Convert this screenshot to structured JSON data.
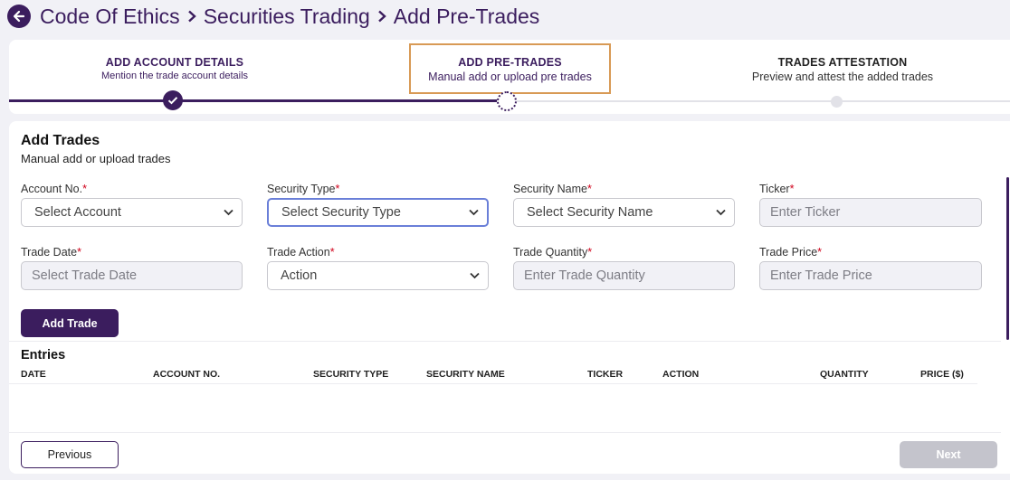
{
  "breadcrumb": {
    "items": [
      "Code Of Ethics",
      "Securities Trading",
      "Add Pre-Trades"
    ]
  },
  "stepper": {
    "steps": [
      {
        "title": "ADD ACCOUNT DETAILS",
        "subtitle": "Mention the trade account details",
        "state": "completed"
      },
      {
        "title": "ADD PRE-TRADES",
        "subtitle": "Manual add or upload pre trades",
        "state": "current"
      },
      {
        "title": "TRADES ATTESTATION",
        "subtitle": "Preview and attest the added trades",
        "state": "upcoming"
      }
    ]
  },
  "form": {
    "title": "Add Trades",
    "subtitle": "Manual add or upload trades",
    "fields": [
      {
        "label": "Account No.",
        "type": "select",
        "value": "Select Account"
      },
      {
        "label": "Security Type",
        "type": "select",
        "value": "Select Security Type"
      },
      {
        "label": "Security Name",
        "type": "select",
        "value": "Select Security Name"
      },
      {
        "label": "Ticker",
        "type": "input",
        "placeholder": "Enter Ticker"
      },
      {
        "label": "Trade Date",
        "type": "input",
        "placeholder": "Select Trade Date"
      },
      {
        "label": "Trade Action",
        "type": "select",
        "value": "Action"
      },
      {
        "label": "Trade Quantity",
        "type": "input",
        "placeholder": "Enter Trade Quantity"
      },
      {
        "label": "Trade Price",
        "type": "input",
        "placeholder": "Enter Trade Price"
      }
    ],
    "required_mark": "*",
    "add_button": "Add Trade"
  },
  "entries": {
    "title": "Entries",
    "columns": [
      "DATE",
      "ACCOUNT NO.",
      "SECURITY TYPE",
      "SECURITY NAME",
      "TICKER",
      "ACTION",
      "QUANTITY",
      "PRICE ($)"
    ],
    "rows": []
  },
  "footer": {
    "previous_label": "Previous",
    "next_label": "Next"
  },
  "colors": {
    "brand": "#3b1d5e",
    "current_step_border": "#d89a55",
    "required": "#d0021b",
    "disabled_button": "#c4c4cc"
  }
}
